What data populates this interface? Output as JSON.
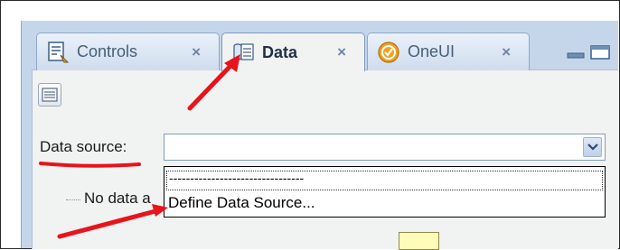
{
  "tabs": [
    {
      "label": "Controls",
      "close": "×",
      "icon": "controls-icon",
      "active": false
    },
    {
      "label": "Data",
      "close": "×",
      "icon": "data-icon",
      "active": true
    },
    {
      "label": "OneUI",
      "close": "×",
      "icon": "oneui-icon",
      "active": false
    }
  ],
  "toolbar": {
    "button_icon": "list-icon"
  },
  "data_source": {
    "label": "Data source:",
    "value": "",
    "options": [
      "--------------------------------",
      "Define Data Source..."
    ]
  },
  "tree": {
    "no_data_label": "No data a"
  },
  "colors": {
    "accent": "#c5d6eb",
    "annotation": "#e8131b",
    "highlight": "#fffbb8"
  }
}
